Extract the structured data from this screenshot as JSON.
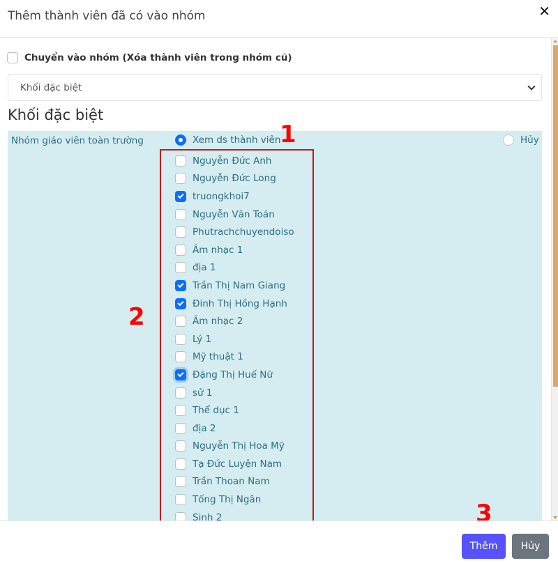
{
  "modal": {
    "title": "Thêm thành viên đã có vào nhóm",
    "close_icon": "close-icon"
  },
  "move_option": {
    "label": "Chuyển vào nhóm (Xóa thành viên trong nhóm cũ)",
    "checked": false
  },
  "group_select": {
    "selected": "Khối đặc biệt"
  },
  "section": {
    "title": "Khối đặc biệt"
  },
  "group": {
    "name": "Nhóm giáo viên toàn trường",
    "view_option": "Xem ds thành viên",
    "cancel_option": "Hủy",
    "selected_option": "view"
  },
  "members": [
    {
      "name": "Nguyễn Đức Anh",
      "checked": false
    },
    {
      "name": "Nguyễn Đức Long",
      "checked": false
    },
    {
      "name": "truongkhoi7",
      "checked": true
    },
    {
      "name": "Nguyễn Văn Toán",
      "checked": false
    },
    {
      "name": "Phutrachchuyendoiso",
      "checked": false
    },
    {
      "name": "Âm nhạc 1",
      "checked": false
    },
    {
      "name": "địa 1",
      "checked": false
    },
    {
      "name": "Trần Thị Nam Giang",
      "checked": true
    },
    {
      "name": "Đinh Thị Hồng Hạnh",
      "checked": true
    },
    {
      "name": "Âm nhạc 2",
      "checked": false
    },
    {
      "name": "Lý 1",
      "checked": false
    },
    {
      "name": "Mỹ thuật 1",
      "checked": false
    },
    {
      "name": "Đặng Thị Huế Nữ",
      "checked": true,
      "focused": true
    },
    {
      "name": "sử 1",
      "checked": false
    },
    {
      "name": "Thể dục 1",
      "checked": false
    },
    {
      "name": "địa 2",
      "checked": false
    },
    {
      "name": "Nguyễn Thị Hoa Mỹ",
      "checked": false
    },
    {
      "name": "Tạ Đức Luyện Nam",
      "checked": false
    },
    {
      "name": "Trần Thoan Nam",
      "checked": false
    },
    {
      "name": "Tống Thị Ngân",
      "checked": false
    },
    {
      "name": "Sinh 2",
      "checked": false
    }
  ],
  "annotations": {
    "one": "1",
    "two": "2",
    "three": "3"
  },
  "footer": {
    "add_label": "Thêm",
    "cancel_label": "Hủy"
  },
  "colors": {
    "primary": "#5752fb",
    "secondary": "#6c757d",
    "panel_bg": "#d5ecf1",
    "annotation": "#ff0000",
    "checkbox_checked": "#0d6efd"
  }
}
